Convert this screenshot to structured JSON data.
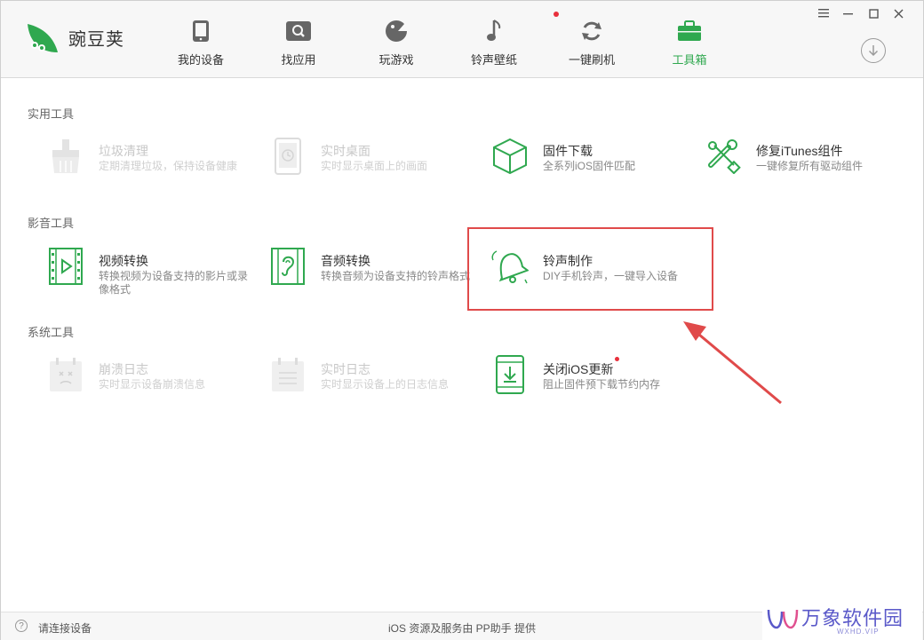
{
  "app": {
    "name": "豌豆荚"
  },
  "nav": {
    "items": [
      {
        "label": "我的设备",
        "icon": "phone-icon"
      },
      {
        "label": "找应用",
        "icon": "app-search-icon"
      },
      {
        "label": "玩游戏",
        "icon": "game-icon"
      },
      {
        "label": "铃声壁纸",
        "icon": "music-note-icon"
      },
      {
        "label": "一键刷机",
        "icon": "refresh-icon"
      },
      {
        "label": "工具箱",
        "icon": "toolbox-icon",
        "active": true,
        "badge_dot": true
      }
    ]
  },
  "sections": [
    {
      "title": "实用工具",
      "tools": [
        {
          "name": "垃圾清理",
          "desc": "定期清理垃圾，保持设备健康",
          "enabled": false,
          "icon": "broom-icon"
        },
        {
          "name": "实时桌面",
          "desc": "实时显示桌面上的画面",
          "enabled": false,
          "icon": "live-desktop-icon"
        },
        {
          "name": "固件下载",
          "desc": "全系列iOS固件匹配",
          "enabled": true,
          "icon": "firmware-box-icon"
        },
        {
          "name": "修复iTunes组件",
          "desc": "一键修复所有驱动组件",
          "enabled": true,
          "icon": "repair-tools-icon"
        }
      ]
    },
    {
      "title": "影音工具",
      "tools": [
        {
          "name": "视频转换",
          "desc": "转换视频为设备支持的影片或录像格式",
          "enabled": true,
          "icon": "video-convert-icon"
        },
        {
          "name": "音频转换",
          "desc": "转换音频为设备支持的铃声格式",
          "enabled": true,
          "icon": "audio-convert-icon"
        },
        {
          "name": "铃声制作",
          "desc": "DIY手机铃声，一键导入设备",
          "enabled": true,
          "icon": "bell-icon"
        }
      ]
    },
    {
      "title": "系统工具",
      "tools": [
        {
          "name": "崩溃日志",
          "desc": "实时显示设备崩溃信息",
          "enabled": false,
          "icon": "crash-log-icon"
        },
        {
          "name": "实时日志",
          "desc": "实时显示设备上的日志信息",
          "enabled": false,
          "icon": "live-log-icon"
        },
        {
          "name": "关闭iOS更新",
          "desc": "阻止固件预下载节约内存",
          "enabled": true,
          "icon": "block-update-icon",
          "badge_dot": true
        }
      ]
    }
  ],
  "status": {
    "left": "请连接设备",
    "center": "iOS 资源及服务由 PP助手 提供"
  },
  "watermark": {
    "text": "万象软件园",
    "sub": "WXHD.VIP"
  },
  "colors": {
    "accent": "#2fa84f",
    "badge": "#e8303c",
    "annotation": "#e04a4a"
  }
}
